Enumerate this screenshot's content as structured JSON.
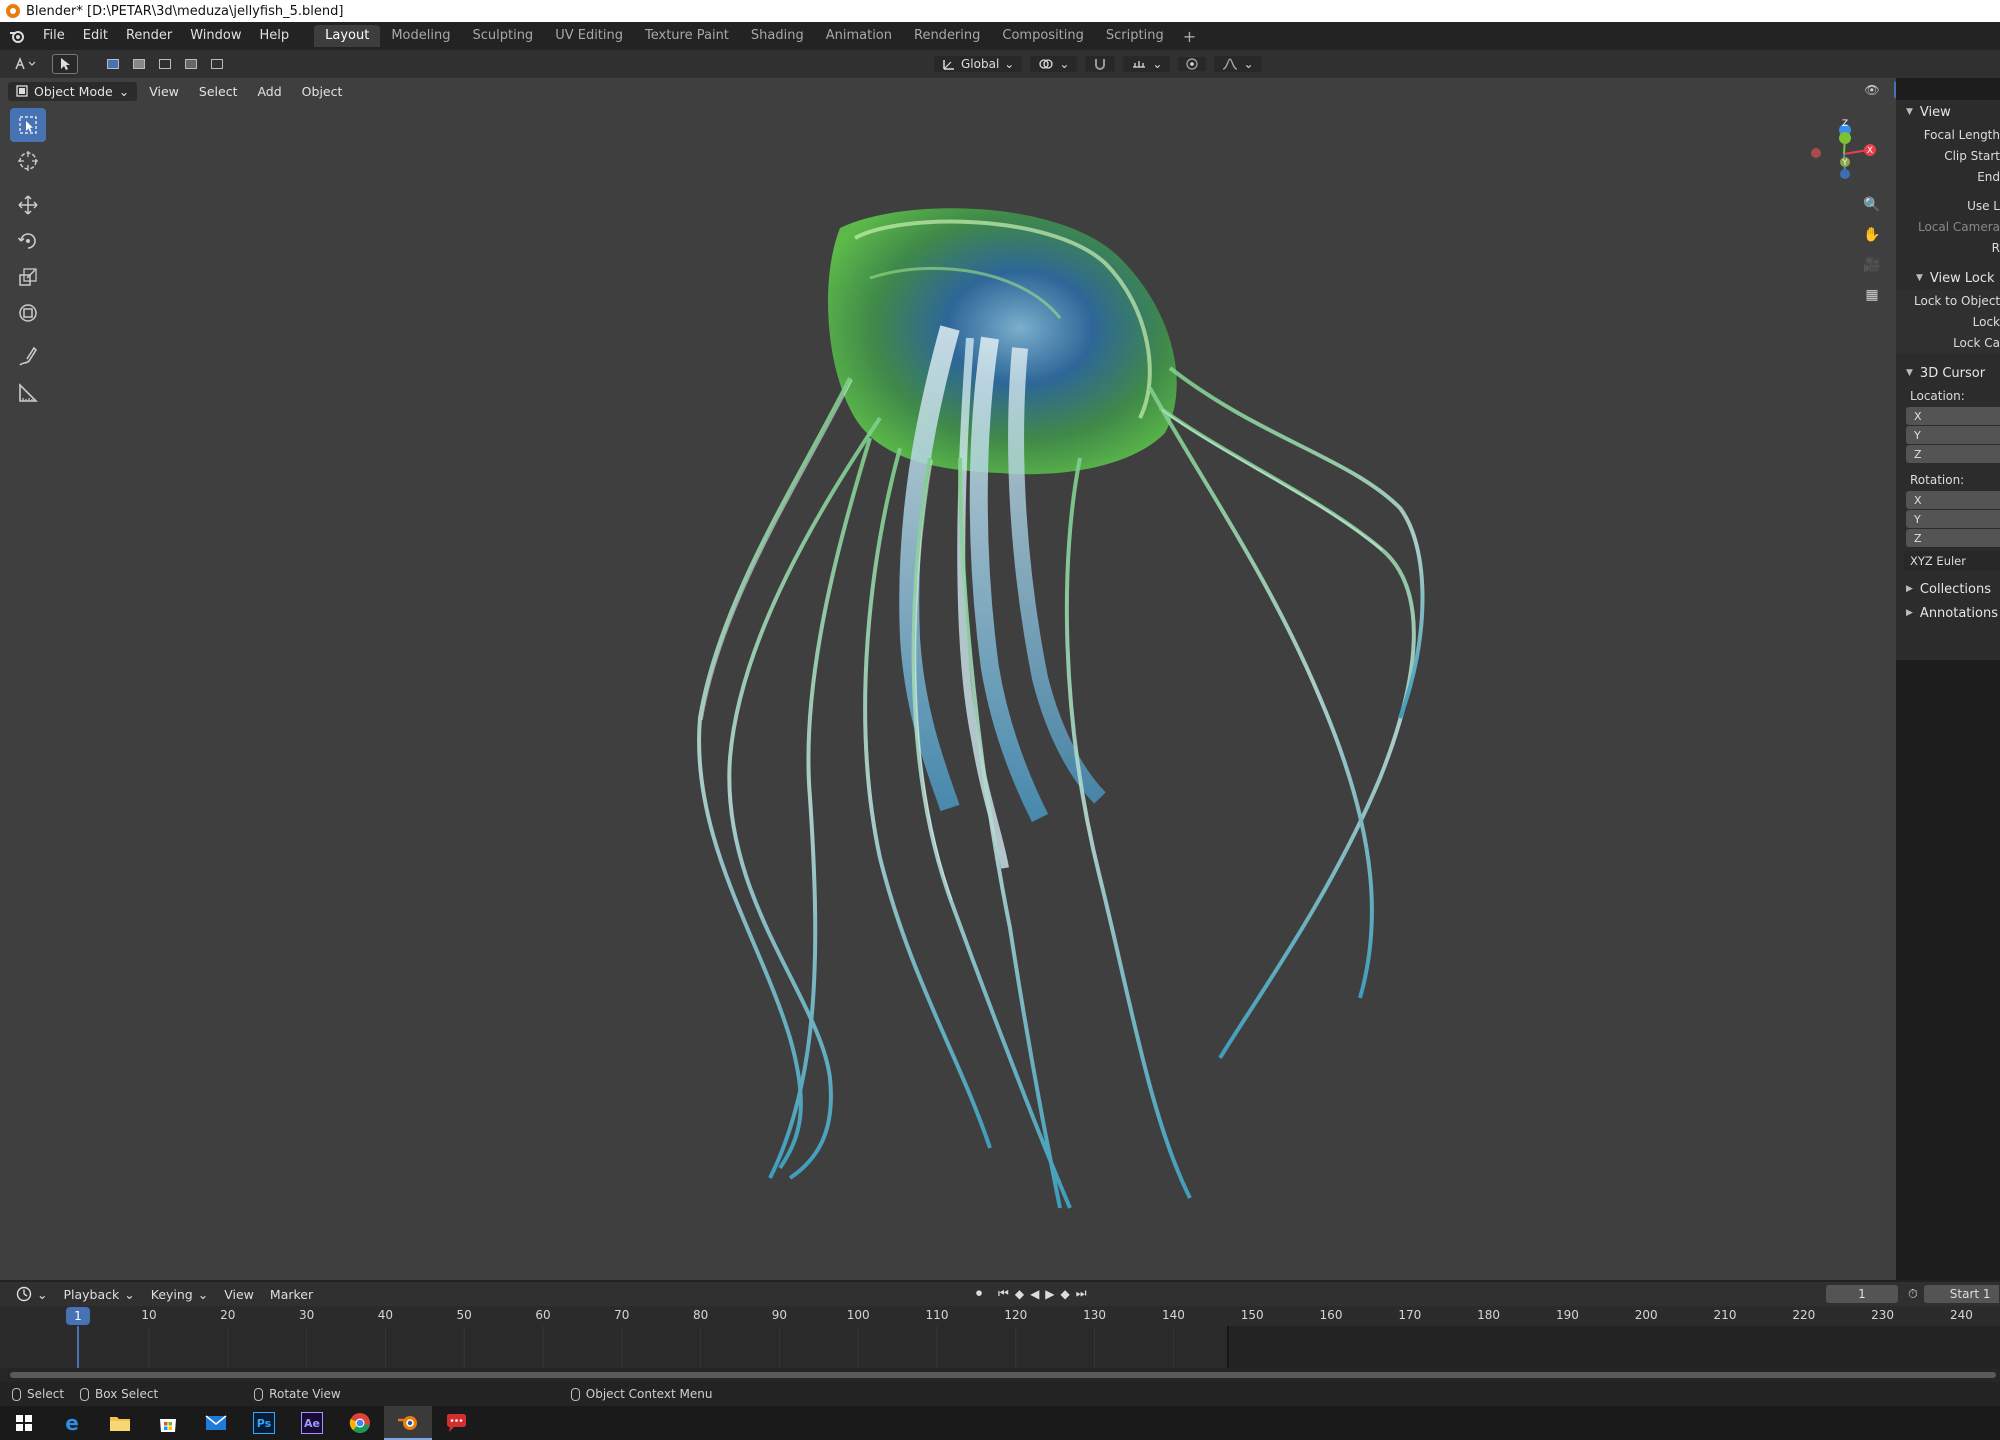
{
  "window": {
    "title": "Blender* [D:\\PETAR\\3d\\meduza\\jellyfish_5.blend]"
  },
  "menubar": {
    "menus": [
      "File",
      "Edit",
      "Render",
      "Window",
      "Help"
    ],
    "workspaces": [
      "Layout",
      "Modeling",
      "Sculpting",
      "UV Editing",
      "Texture Paint",
      "Shading",
      "Animation",
      "Rendering",
      "Compositing",
      "Scripting"
    ],
    "active_workspace": "Layout",
    "add_symbol": "+"
  },
  "toolheader": {
    "orientation": "Global"
  },
  "viewport": {
    "mode": "Object Mode",
    "menus": [
      "View",
      "Select",
      "Add",
      "Object"
    ],
    "gizmo": {
      "x": "X",
      "y": "Y",
      "z": "Z"
    }
  },
  "npanel": {
    "view_section": "View",
    "focal_length": "Focal Length",
    "clip_start": "Clip Start",
    "end": "End",
    "use_local": "Use L",
    "local_camera": "Local Camera",
    "render_region": "R",
    "view_lock_section": "View Lock",
    "lock_to_object": "Lock to Object",
    "lock": "Lock",
    "lock_camera": "Lock Ca",
    "cursor_section": "3D Cursor",
    "location_label": "Location:",
    "rotation_label": "Rotation:",
    "loc_axes": [
      "X",
      "Y",
      "Z"
    ],
    "rot_axes": [
      "X",
      "Y",
      "Z"
    ],
    "rotation_mode": "XYZ Euler",
    "collections": "Collections",
    "annotations": "Annotations"
  },
  "timeline": {
    "menus": [
      "Playback",
      "Keying",
      "View",
      "Marker"
    ],
    "current_frame": "1",
    "start_label": "Start",
    "start_value": "1",
    "ruler_ticks": [
      "10",
      "20",
      "30",
      "40",
      "50",
      "60",
      "70",
      "80",
      "90",
      "100",
      "110",
      "120",
      "130",
      "140",
      "150",
      "160",
      "170",
      "180",
      "190",
      "200",
      "210",
      "220",
      "230",
      "240"
    ],
    "cursor_frame": "1"
  },
  "statusbar": {
    "select": "Select",
    "box_select": "Box Select",
    "rotate_view": "Rotate View",
    "context_menu": "Object Context Menu"
  },
  "taskbar": {
    "apps": [
      "windows-start-icon",
      "edge-icon",
      "file-explorer-icon",
      "store-icon",
      "mail-icon",
      "photoshop-icon",
      "after-effects-icon",
      "chrome-icon",
      "blender-icon",
      "chat-icon"
    ],
    "ps_label": "Ps",
    "ae_label": "Ae"
  },
  "colors": {
    "accent": "#4772b3",
    "viewport_bg": "#3f3f3f",
    "x_axis": "#e8404a",
    "y_axis": "#7ec232",
    "z_axis": "#3b8ee8"
  }
}
